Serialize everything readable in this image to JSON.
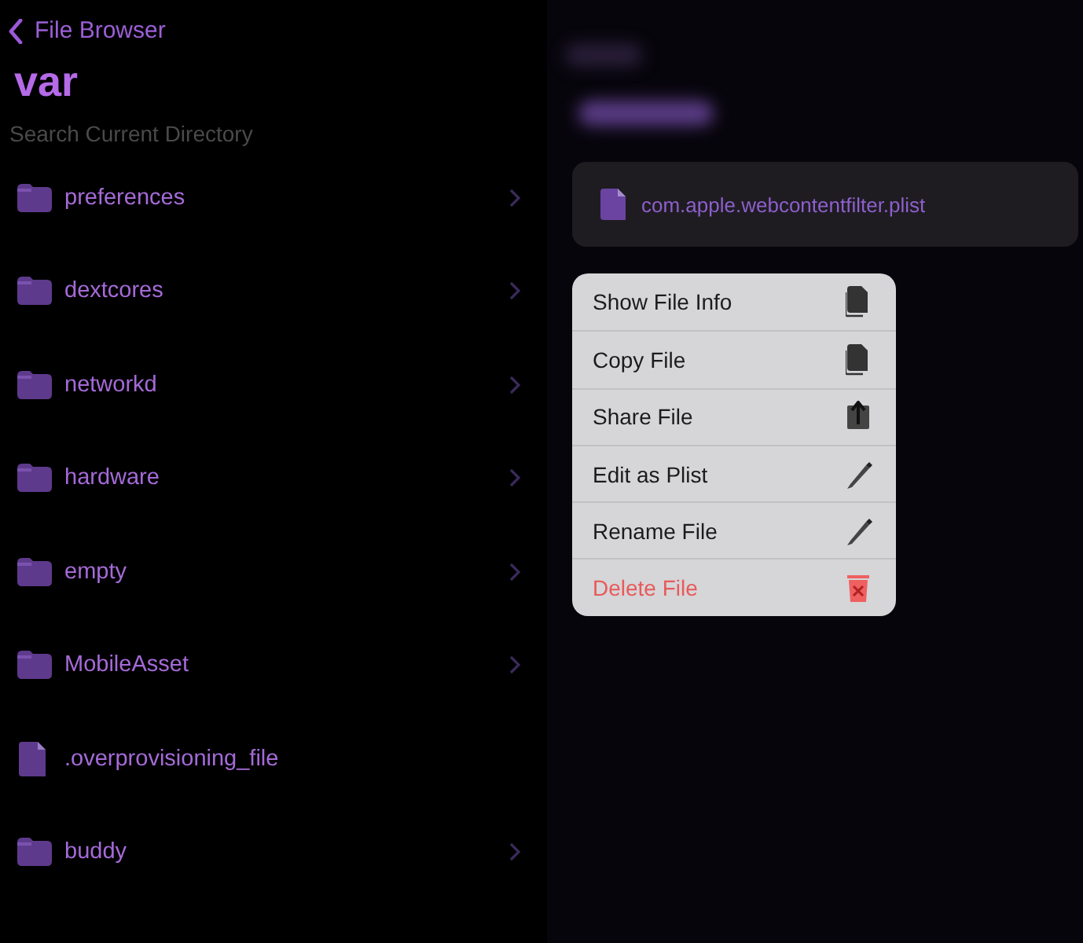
{
  "nav": {
    "back_label": "File Browser"
  },
  "title": "var",
  "search": {
    "placeholder": "Search Current Directory"
  },
  "entries": [
    {
      "kind": "folder",
      "name": "preferences"
    },
    {
      "kind": "folder",
      "name": "dextcores"
    },
    {
      "kind": "folder",
      "name": "networkd"
    },
    {
      "kind": "folder",
      "name": "hardware"
    },
    {
      "kind": "folder",
      "name": "empty"
    },
    {
      "kind": "folder",
      "name": "MobileAsset"
    },
    {
      "kind": "file",
      "name": ".overprovisioning_file"
    },
    {
      "kind": "folder",
      "name": "buddy"
    }
  ],
  "preview": {
    "file_name": "com.apple.webcontentfilter.plist"
  },
  "context_menu": [
    {
      "label": "Show File Info",
      "kind": "doc",
      "destructive": false
    },
    {
      "label": "Copy File",
      "kind": "doc",
      "destructive": false
    },
    {
      "label": "Share File",
      "kind": "share",
      "destructive": false
    },
    {
      "label": "Edit as Plist",
      "kind": "pencil",
      "destructive": false
    },
    {
      "label": "Rename File",
      "kind": "pencil",
      "destructive": false
    },
    {
      "label": "Delete File",
      "kind": "trash",
      "destructive": true
    }
  ]
}
